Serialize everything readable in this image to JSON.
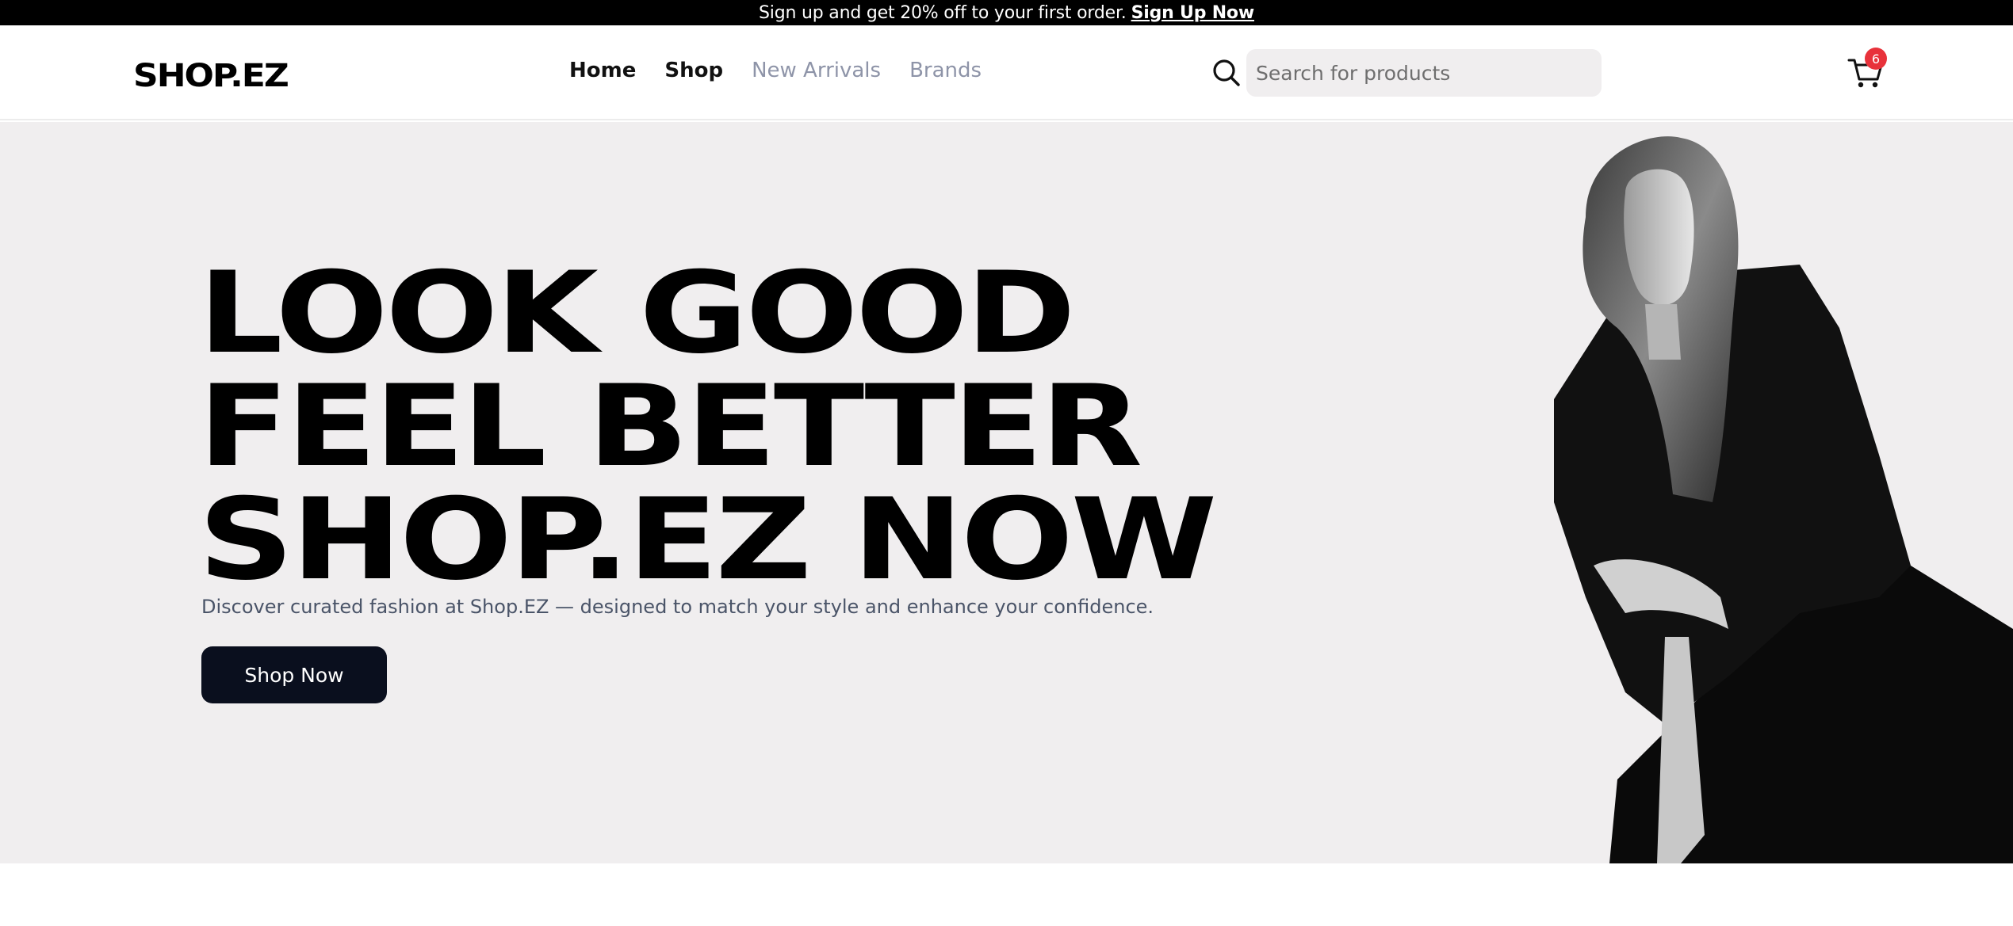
{
  "promo": {
    "text": "Sign up and get 20% off to your first order.",
    "link": "Sign Up Now"
  },
  "header": {
    "logo": "SHOP.EZ",
    "nav": [
      "Home",
      "Shop",
      "New Arrivals",
      "Brands"
    ],
    "search_placeholder": "Search for products",
    "cart_count": "6"
  },
  "hero": {
    "title_lines": [
      "LOOK GOOD",
      "FEEL BETTER",
      "SHOP.EZ NOW"
    ],
    "subtitle": "Discover curated fashion at Shop.EZ — designed to match your style and enhance your confidence.",
    "cta": "Shop Now"
  },
  "colors": {
    "promo_bg": "#000000",
    "hero_bg": "#f0eeef",
    "cta_bg": "#0a0f1e",
    "badge": "#e8323b",
    "nav_muted": "#8e94a8"
  },
  "icons": {
    "search": "search-icon",
    "cart": "cart-icon"
  }
}
